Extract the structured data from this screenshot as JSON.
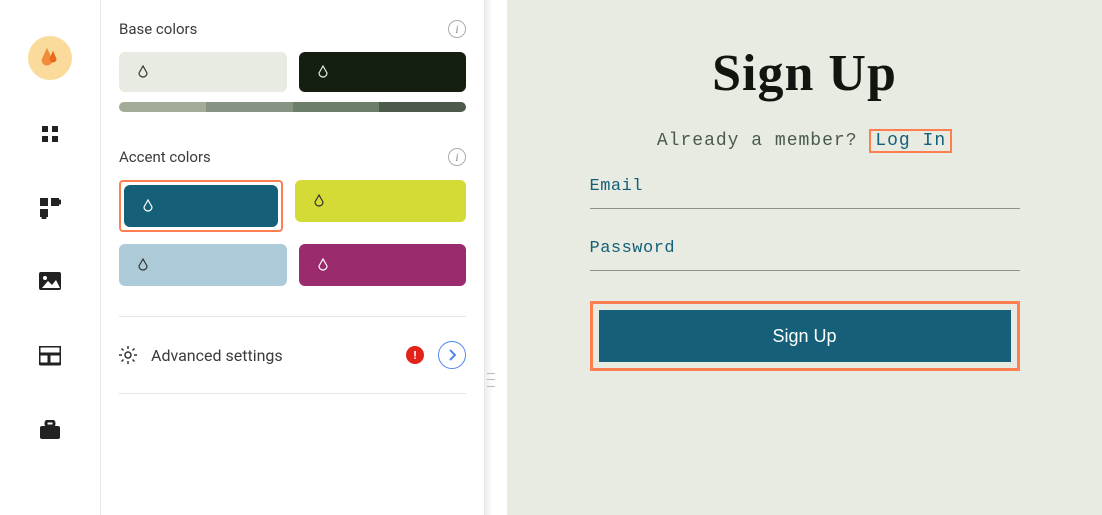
{
  "panel": {
    "base_colors_label": "Base colors",
    "accent_colors_label": "Accent colors",
    "advanced_label": "Advanced settings",
    "alert_icon": "!",
    "base_swatches": {
      "light": "#E8EBE1",
      "dark": "#141F0F"
    },
    "gradient_segments": [
      "#A2AC99",
      "#879483",
      "#6C7E6A",
      "#4D594B"
    ],
    "accent_swatches": {
      "teal": "#156078",
      "lime": "#D5DB36",
      "lightblue": "#ACCAD7",
      "magenta": "#9A2B6C"
    }
  },
  "preview": {
    "title": "Sign Up",
    "sub_prefix": "Already a member? ",
    "login_link": "Log In",
    "email_label": "Email",
    "password_label": "Password",
    "button_label": "Sign Up"
  }
}
